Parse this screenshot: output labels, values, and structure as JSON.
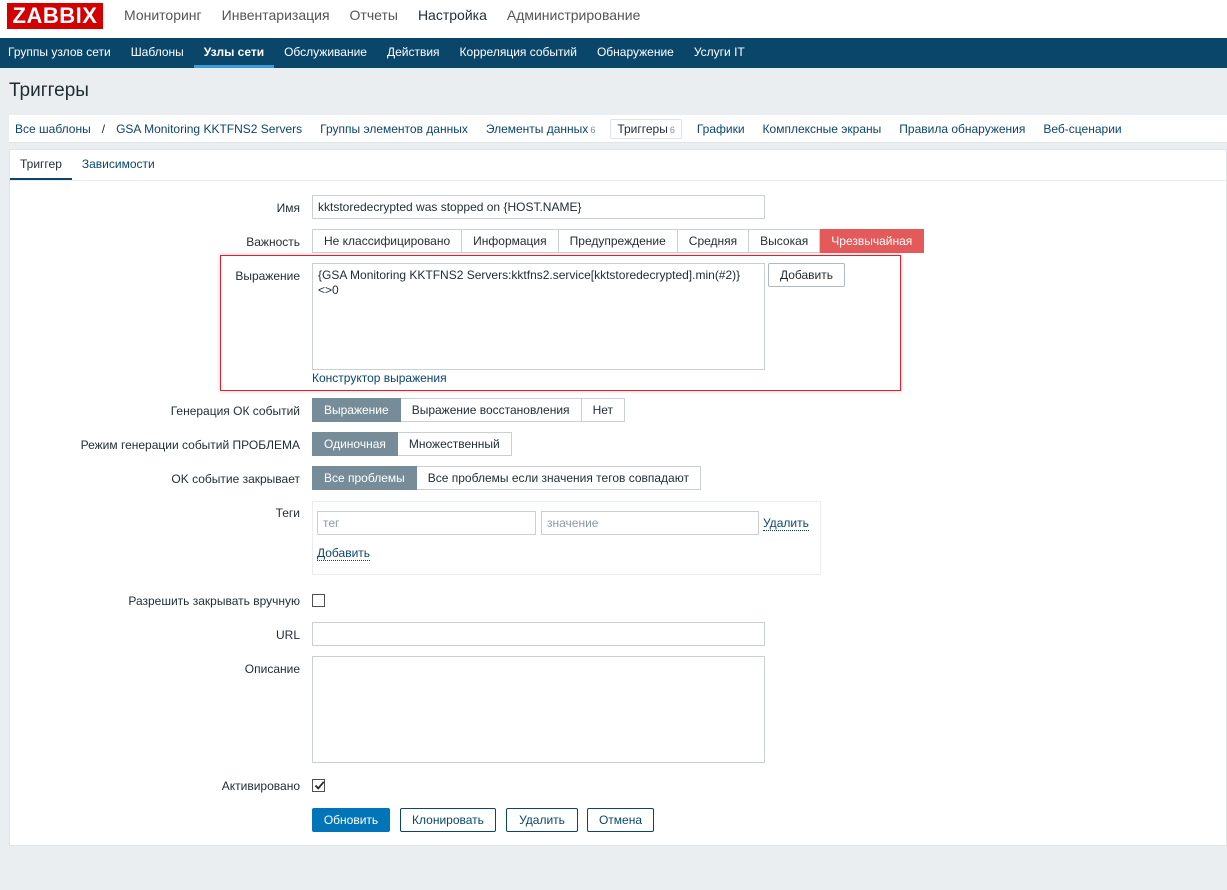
{
  "header": {
    "logo": "ZABBIX",
    "menu": [
      "Мониторинг",
      "Инвентаризация",
      "Отчеты",
      "Настройка",
      "Администрирование"
    ]
  },
  "subnav": [
    "Группы узлов сети",
    "Шаблоны",
    "Узлы сети",
    "Обслуживание",
    "Действия",
    "Корреляция событий",
    "Обнаружение",
    "Услуги IT"
  ],
  "page": {
    "title": "Триггеры"
  },
  "crumbs": {
    "all_templates": "Все шаблоны",
    "template": "GSA Monitoring KKTFNS2 Servers",
    "app_groups": "Группы элементов данных",
    "items": "Элементы данных",
    "items_count": "6",
    "triggers": "Триггеры",
    "triggers_count": "6",
    "graphs": "Графики",
    "screens": "Комплексные экраны",
    "discovery": "Правила обнаружения",
    "web": "Веб-сценарии"
  },
  "tabs": [
    "Триггер",
    "Зависимости"
  ],
  "form": {
    "name_label": "Имя",
    "name_value": "kktstoredecrypted was stopped on {HOST.NAME}",
    "severity_label": "Важность",
    "severity_options": [
      "Не классифицировано",
      "Информация",
      "Предупреждение",
      "Средняя",
      "Высокая",
      "Чрезвычайная"
    ],
    "expression_label": "Выражение",
    "expression_value": "{GSA Monitoring KKTFNS2 Servers:kktfns2.service[kktstoredecrypted].min(#2)}\n<>0",
    "add_button": "Добавить",
    "constructor_link": "Конструктор выражения",
    "ok_gen_label": "Генерация ОК событий",
    "ok_gen_options": [
      "Выражение",
      "Выражение восстановления",
      "Нет"
    ],
    "problem_mode_label": "Режим генерации событий ПРОБЛЕМА",
    "problem_mode_options": [
      "Одиночная",
      "Множественный"
    ],
    "ok_closes_label": "OK событие закрывает",
    "ok_closes_options": [
      "Все проблемы",
      "Все проблемы если значения тегов совпадают"
    ],
    "tags_label": "Теги",
    "tag_placeholder": "тег",
    "value_placeholder": "значение",
    "tag_remove": "Удалить",
    "tag_add": "Добавить",
    "manual_close_label": "Разрешить закрывать вручную",
    "manual_close_checked": false,
    "url_label": "URL",
    "url_value": "",
    "description_label": "Описание",
    "description_value": "",
    "enabled_label": "Активировано",
    "enabled_checked": true
  },
  "buttons": {
    "update": "Обновить",
    "clone": "Клонировать",
    "delete": "Удалить",
    "cancel": "Отмена"
  },
  "colors": {
    "header_nav": "#0a466a",
    "logo": "#d40000",
    "selected_segment": "#768d99",
    "disaster": "#e45959",
    "primary_button": "#0275b8",
    "highlight_box": "#e0202a"
  }
}
